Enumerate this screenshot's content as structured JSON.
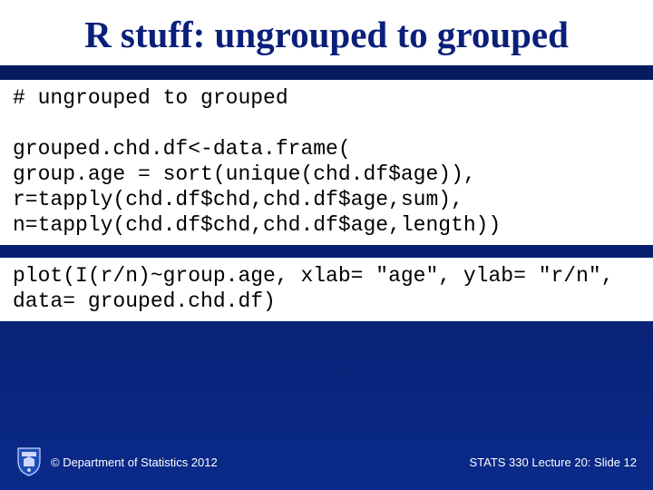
{
  "title": "R stuff: ungrouped to grouped",
  "code": {
    "block1": "# ungrouped to grouped\n\ngrouped.chd.df<-data.frame(\ngroup.age = sort(unique(chd.df$age)),\nr=tapply(chd.df$chd,chd.df$age,sum),\nn=tapply(chd.df$chd,chd.df$age,length))",
    "block2": "plot(I(r/n)~group.age, xlab= \"age\", ylab= \"r/n\",\ndata= grouped.chd.df)"
  },
  "footer": {
    "copyright": "© Department of Statistics 2012",
    "slide_ref": "STATS 330 Lecture 20: Slide 12"
  }
}
